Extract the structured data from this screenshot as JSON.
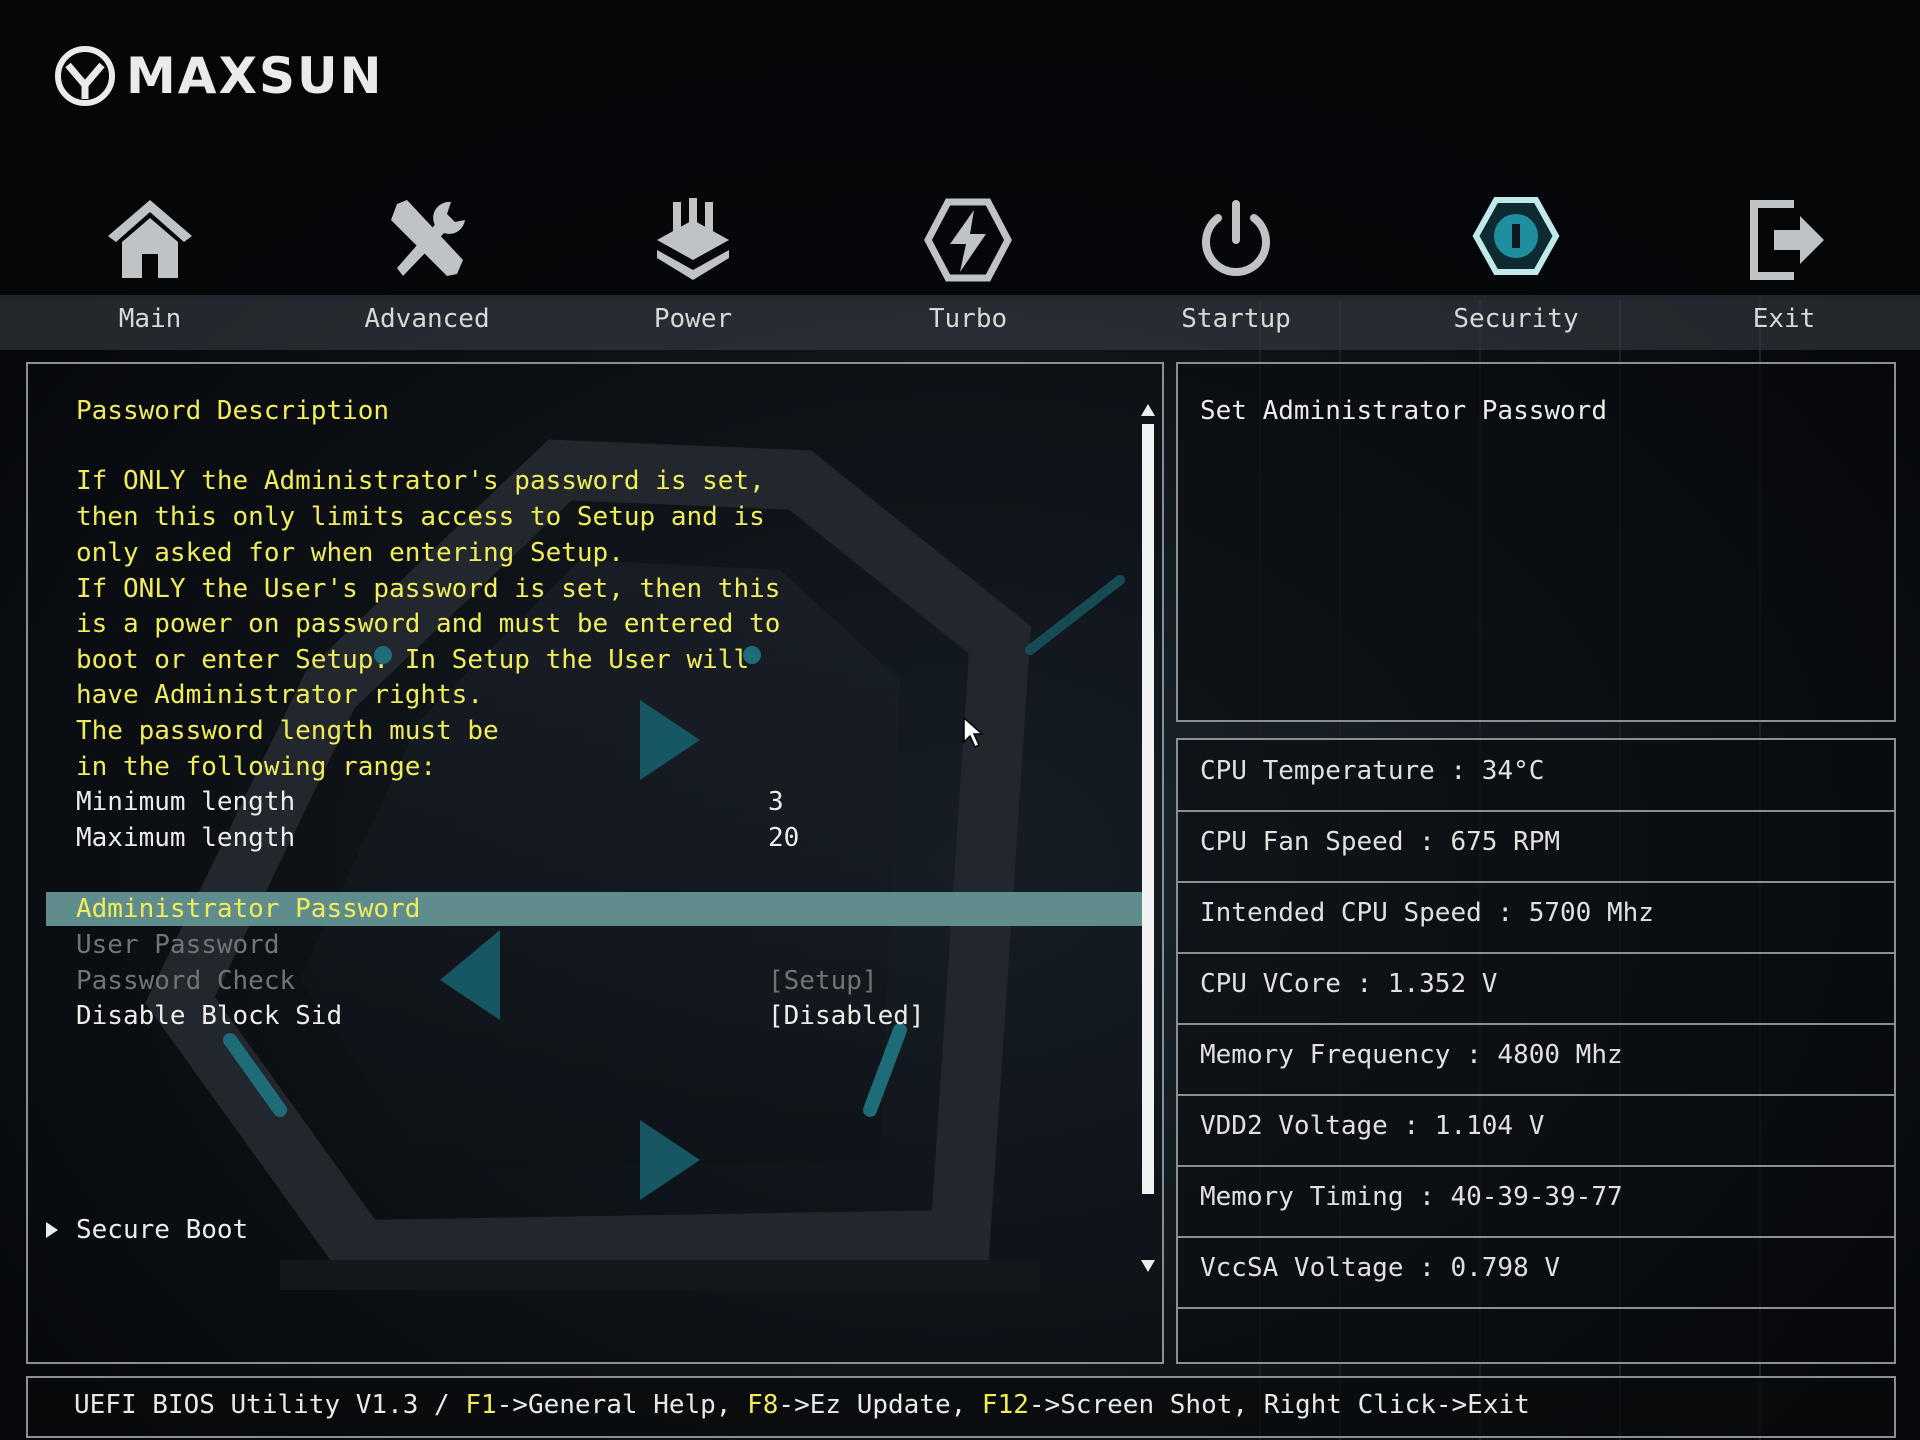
{
  "brand": {
    "name": "MAXSUN"
  },
  "nav": {
    "active": "Security",
    "items": [
      {
        "label": "Main",
        "icon": "home-icon"
      },
      {
        "label": "Advanced",
        "icon": "tools-icon"
      },
      {
        "label": "Power",
        "icon": "power-chip-icon"
      },
      {
        "label": "Turbo",
        "icon": "lightning-icon"
      },
      {
        "label": "Startup",
        "icon": "power-button-icon"
      },
      {
        "label": "Security",
        "icon": "shield-icon"
      },
      {
        "label": "Exit",
        "icon": "exit-icon"
      }
    ]
  },
  "main": {
    "description_title": "Password Description",
    "description_lines": [
      "If ONLY the Administrator's password is set,",
      "then this only limits access to Setup and is",
      "only asked for when entering Setup.",
      "If ONLY the User's password is set, then this",
      "is a power on password and must be entered to",
      "boot or enter Setup. In Setup the User will",
      "have Administrator rights.",
      "The password length must be",
      "in the following range:"
    ],
    "min_length_label": "Minimum length",
    "min_length_value": "3",
    "max_length_label": "Maximum length",
    "max_length_value": "20",
    "admin_password_label": "Administrator Password",
    "user_password_label": "User Password",
    "password_check_label": "Password Check",
    "password_check_value": "[Setup]",
    "block_sid_label": "Disable Block Sid",
    "block_sid_value": "[Disabled]",
    "secure_boot_label": "Secure Boot"
  },
  "help": {
    "text": "Set Administrator Password"
  },
  "stats": [
    "CPU Temperature : 34°C",
    "CPU Fan Speed : 675 RPM",
    "Intended CPU Speed : 5700 Mhz",
    "CPU VCore : 1.352 V",
    "Memory Frequency : 4800 Mhz",
    "VDD2 Voltage : 1.104 V",
    "Memory Timing : 40-39-39-77",
    "VccSA Voltage : 0.798 V"
  ],
  "status": {
    "prefix": "UEFI BIOS Utility V1.3 / ",
    "f1_key": "F1",
    "f1_text": "->General Help, ",
    "f8_key": "F8",
    "f8_text": "->Ez Update, ",
    "f12_key": "F12",
    "f12_text": "->Screen Shot, Right Click->Exit"
  },
  "colors": {
    "highlight_text": "#f1ec5a",
    "selection_bar": "#5f8d8e",
    "accent_teal": "#1f7f8f"
  }
}
